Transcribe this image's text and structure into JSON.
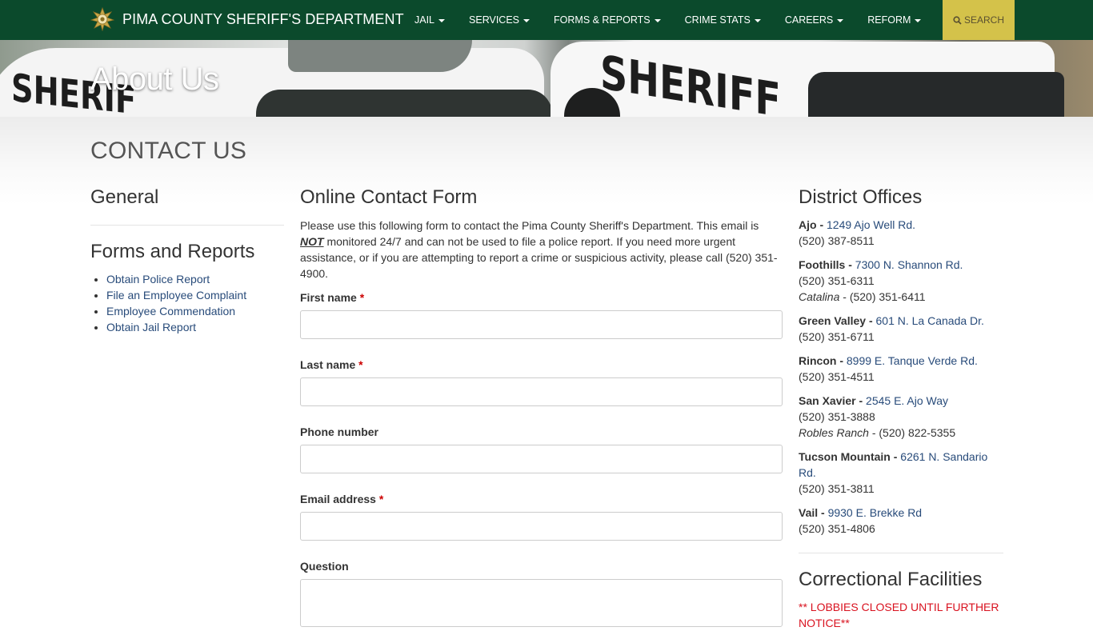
{
  "nav": {
    "brand_title": "PIMA COUNTY SHERIFF'S DEPARTMENT",
    "items": [
      {
        "label": "JAIL"
      },
      {
        "label": "SERVICES"
      },
      {
        "label": "FORMS & REPORTS"
      },
      {
        "label": "CRIME STATS"
      },
      {
        "label": "CAREERS"
      },
      {
        "label": "REFORM"
      }
    ],
    "search_label": "SEARCH"
  },
  "hero": {
    "title": "About Us",
    "vehicle_text_left": "SHERIF",
    "vehicle_text_right": "SHERIFF"
  },
  "page": {
    "heading": "CONTACT US"
  },
  "left": {
    "general_heading": "General",
    "forms_heading": "Forms and Reports",
    "links": [
      {
        "label": "Obtain Police Report"
      },
      {
        "label": "File an Employee Complaint"
      },
      {
        "label": "Employee Commendation"
      },
      {
        "label": "Obtain Jail Report"
      }
    ]
  },
  "form": {
    "heading": "Online Contact Form",
    "intro_before": "Please use this following form to contact the Pima County Sheriff's Department. This email is ",
    "intro_emph": "NOT",
    "intro_after": " monitored 24/7 and can not be used to file a police report. If you need more urgent assistance, or if you are attempting to report a crime or suspicious activity, please call (520) 351-4900.",
    "required_mark": "*",
    "fields": {
      "first_name": {
        "label": "First name",
        "value": ""
      },
      "last_name": {
        "label": "Last name",
        "value": ""
      },
      "phone": {
        "label": "Phone number",
        "value": ""
      },
      "email": {
        "label": "Email address",
        "value": ""
      },
      "question": {
        "label": "Question",
        "value": ""
      }
    }
  },
  "right": {
    "districts_heading": "District Offices",
    "offices": [
      {
        "name": "Ajo -",
        "address": "1249 Ajo Well Rd.",
        "phone": "(520) 387-8511"
      },
      {
        "name": "Foothills -",
        "address": "7300 N. Shannon Rd.",
        "phone": "(520) 351-6311",
        "sub_name": "Catalina",
        "sub_phone": " - (520) 351-6411"
      },
      {
        "name": "Green Valley -",
        "address": "601 N. La Canada Dr.",
        "phone": "(520) 351-6711"
      },
      {
        "name": "Rincon -",
        "address": "8999 E. Tanque Verde Rd.",
        "phone": "(520) 351-4511"
      },
      {
        "name": "San Xavier -",
        "address": "2545 E. Ajo Way",
        "phone": "(520) 351-3888",
        "sub_name": "Robles Ranch",
        "sub_phone": " - (520) 822-5355"
      },
      {
        "name": "Tucson Mountain -",
        "address": "6261 N. Sandario Rd.",
        "phone": "(520) 351-3811"
      },
      {
        "name": "Vail -",
        "address": "9930 E. Brekke Rd",
        "phone": "(520) 351-4806"
      }
    ],
    "facilities_heading": "Correctional Facilities",
    "notice": "** LOBBIES CLOSED UNTIL FURTHER NOTICE**"
  },
  "colors": {
    "nav_bg": "#0b4a2c",
    "search_bg": "#d4c24a",
    "link": "#284b7a",
    "required": "#cc0000",
    "notice": "#d9121f"
  }
}
